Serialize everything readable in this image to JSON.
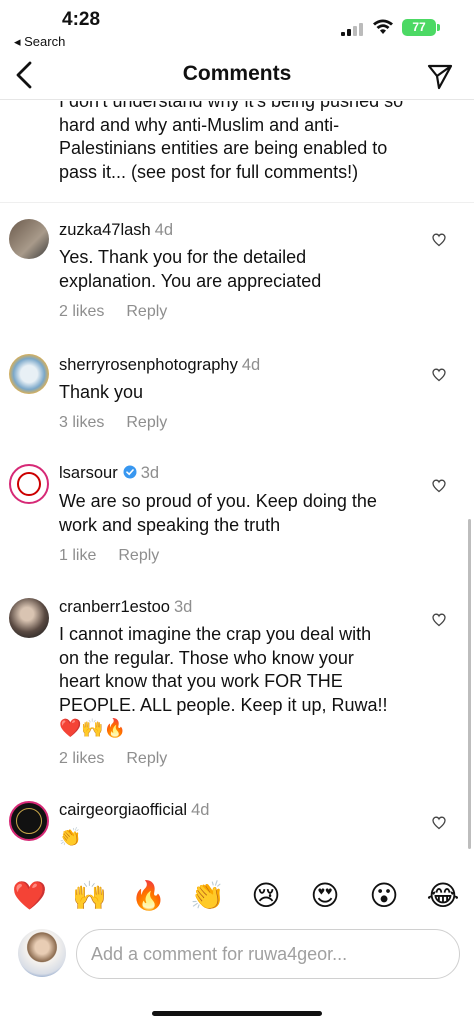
{
  "status": {
    "time": "4:28",
    "back_app": "◂ Search",
    "battery": "77"
  },
  "header": {
    "title": "Comments"
  },
  "caption": {
    "text_lines": [
      "I don't understand why it's being pushed so",
      "hard and why anti-Muslim and anti-",
      "Palestinians entities are being enabled to",
      "pass it... (see post for full comments!)"
    ]
  },
  "comments": [
    {
      "username": "zuzka47lash",
      "time": "4d",
      "verified": false,
      "text_lines": [
        "Yes. Thank you for the detailed",
        "explanation. You are appreciated"
      ],
      "likes": "2 likes",
      "reply": "Reply"
    },
    {
      "username": "sherryrosenphotography",
      "time": "4d",
      "verified": false,
      "text_lines": [
        "Thank you"
      ],
      "likes": "3 likes",
      "reply": "Reply"
    },
    {
      "username": "lsarsour",
      "time": "3d",
      "verified": true,
      "text_lines": [
        "We are so proud of you. Keep doing the",
        "work and speaking the truth"
      ],
      "likes": "1 like",
      "reply": "Reply"
    },
    {
      "username": "cranberr1estoo",
      "time": "3d",
      "verified": false,
      "text_lines": [
        "I cannot imagine the crap you deal with",
        "on the regular. Those who know your",
        "heart know that you work FOR THE",
        "PEOPLE. ALL people. Keep it up, Ruwa!!",
        "❤️🙌🔥"
      ],
      "likes": "2 likes",
      "reply": "Reply"
    },
    {
      "username": "cairgeorgiaofficial",
      "time": "4d",
      "verified": false,
      "text_lines": [
        "👏"
      ],
      "likes": "",
      "reply": ""
    }
  ],
  "emoji_bar": [
    "❤️",
    "🙌",
    "🔥",
    "👏",
    "😢",
    "😍",
    "😮",
    "😂"
  ],
  "composer": {
    "placeholder": "Add a comment for ruwa4geor..."
  },
  "colors": {
    "verified": "#3897f0",
    "battery": "#4cd964",
    "muted": "#8e8e8e"
  }
}
